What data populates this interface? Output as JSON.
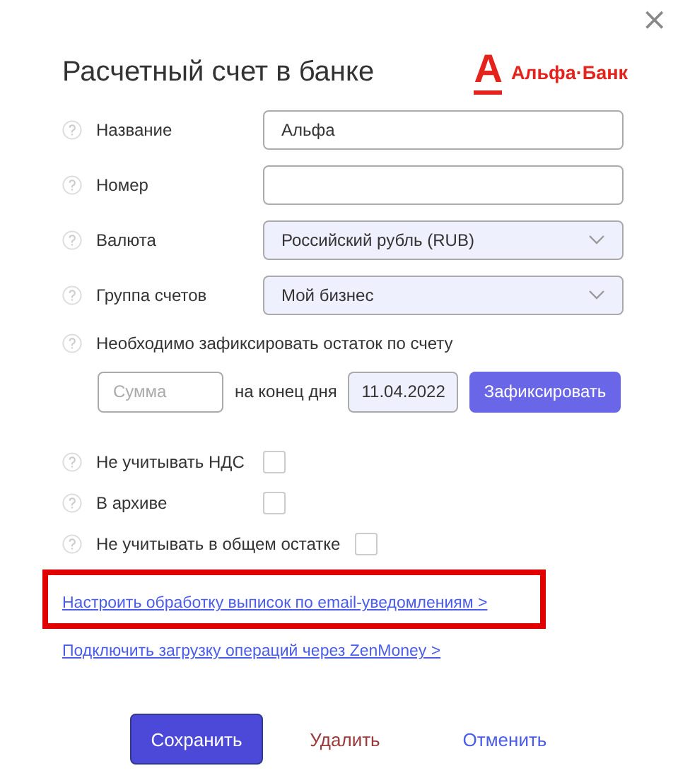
{
  "dialog": {
    "title": "Расчетный счет в банке",
    "close": "×"
  },
  "logo": {
    "mark": "А",
    "name": "Альфа·Банк"
  },
  "fields": [
    {
      "label": "Название",
      "kind": "text",
      "value": "Альфа"
    },
    {
      "label": "Номер",
      "kind": "text"
    },
    {
      "label": "Валюта",
      "kind": "select",
      "value": "Российский рубль (RUB)"
    },
    {
      "label": "Группа счетов",
      "kind": "select",
      "value": "Мой бизнес"
    }
  ],
  "balance": {
    "label": "Необходимо зафиксировать остаток по счету",
    "amount_placeholder": "Сумма",
    "date_label": "на конец дня",
    "date": "11.04.2022",
    "button": "Зафиксировать"
  },
  "checkboxes": [
    {
      "label": "Не учитывать НДС",
      "checked": false
    },
    {
      "label": "В архиве",
      "checked": false
    },
    {
      "label": "Не учитывать в общем остатке",
      "checked": false
    }
  ],
  "links": [
    {
      "text": "Настроить обработку выписок по email-уведомлениям >",
      "highlighted": true
    },
    {
      "text": "Подключить загрузку операций через ZenMoney >",
      "highlighted": false
    }
  ],
  "buttons": [
    {
      "label": "Сохранить",
      "kind": "primary"
    },
    {
      "label": "Удалить",
      "kind": "danger"
    },
    {
      "label": "Отменить",
      "kind": "secondary"
    }
  ]
}
